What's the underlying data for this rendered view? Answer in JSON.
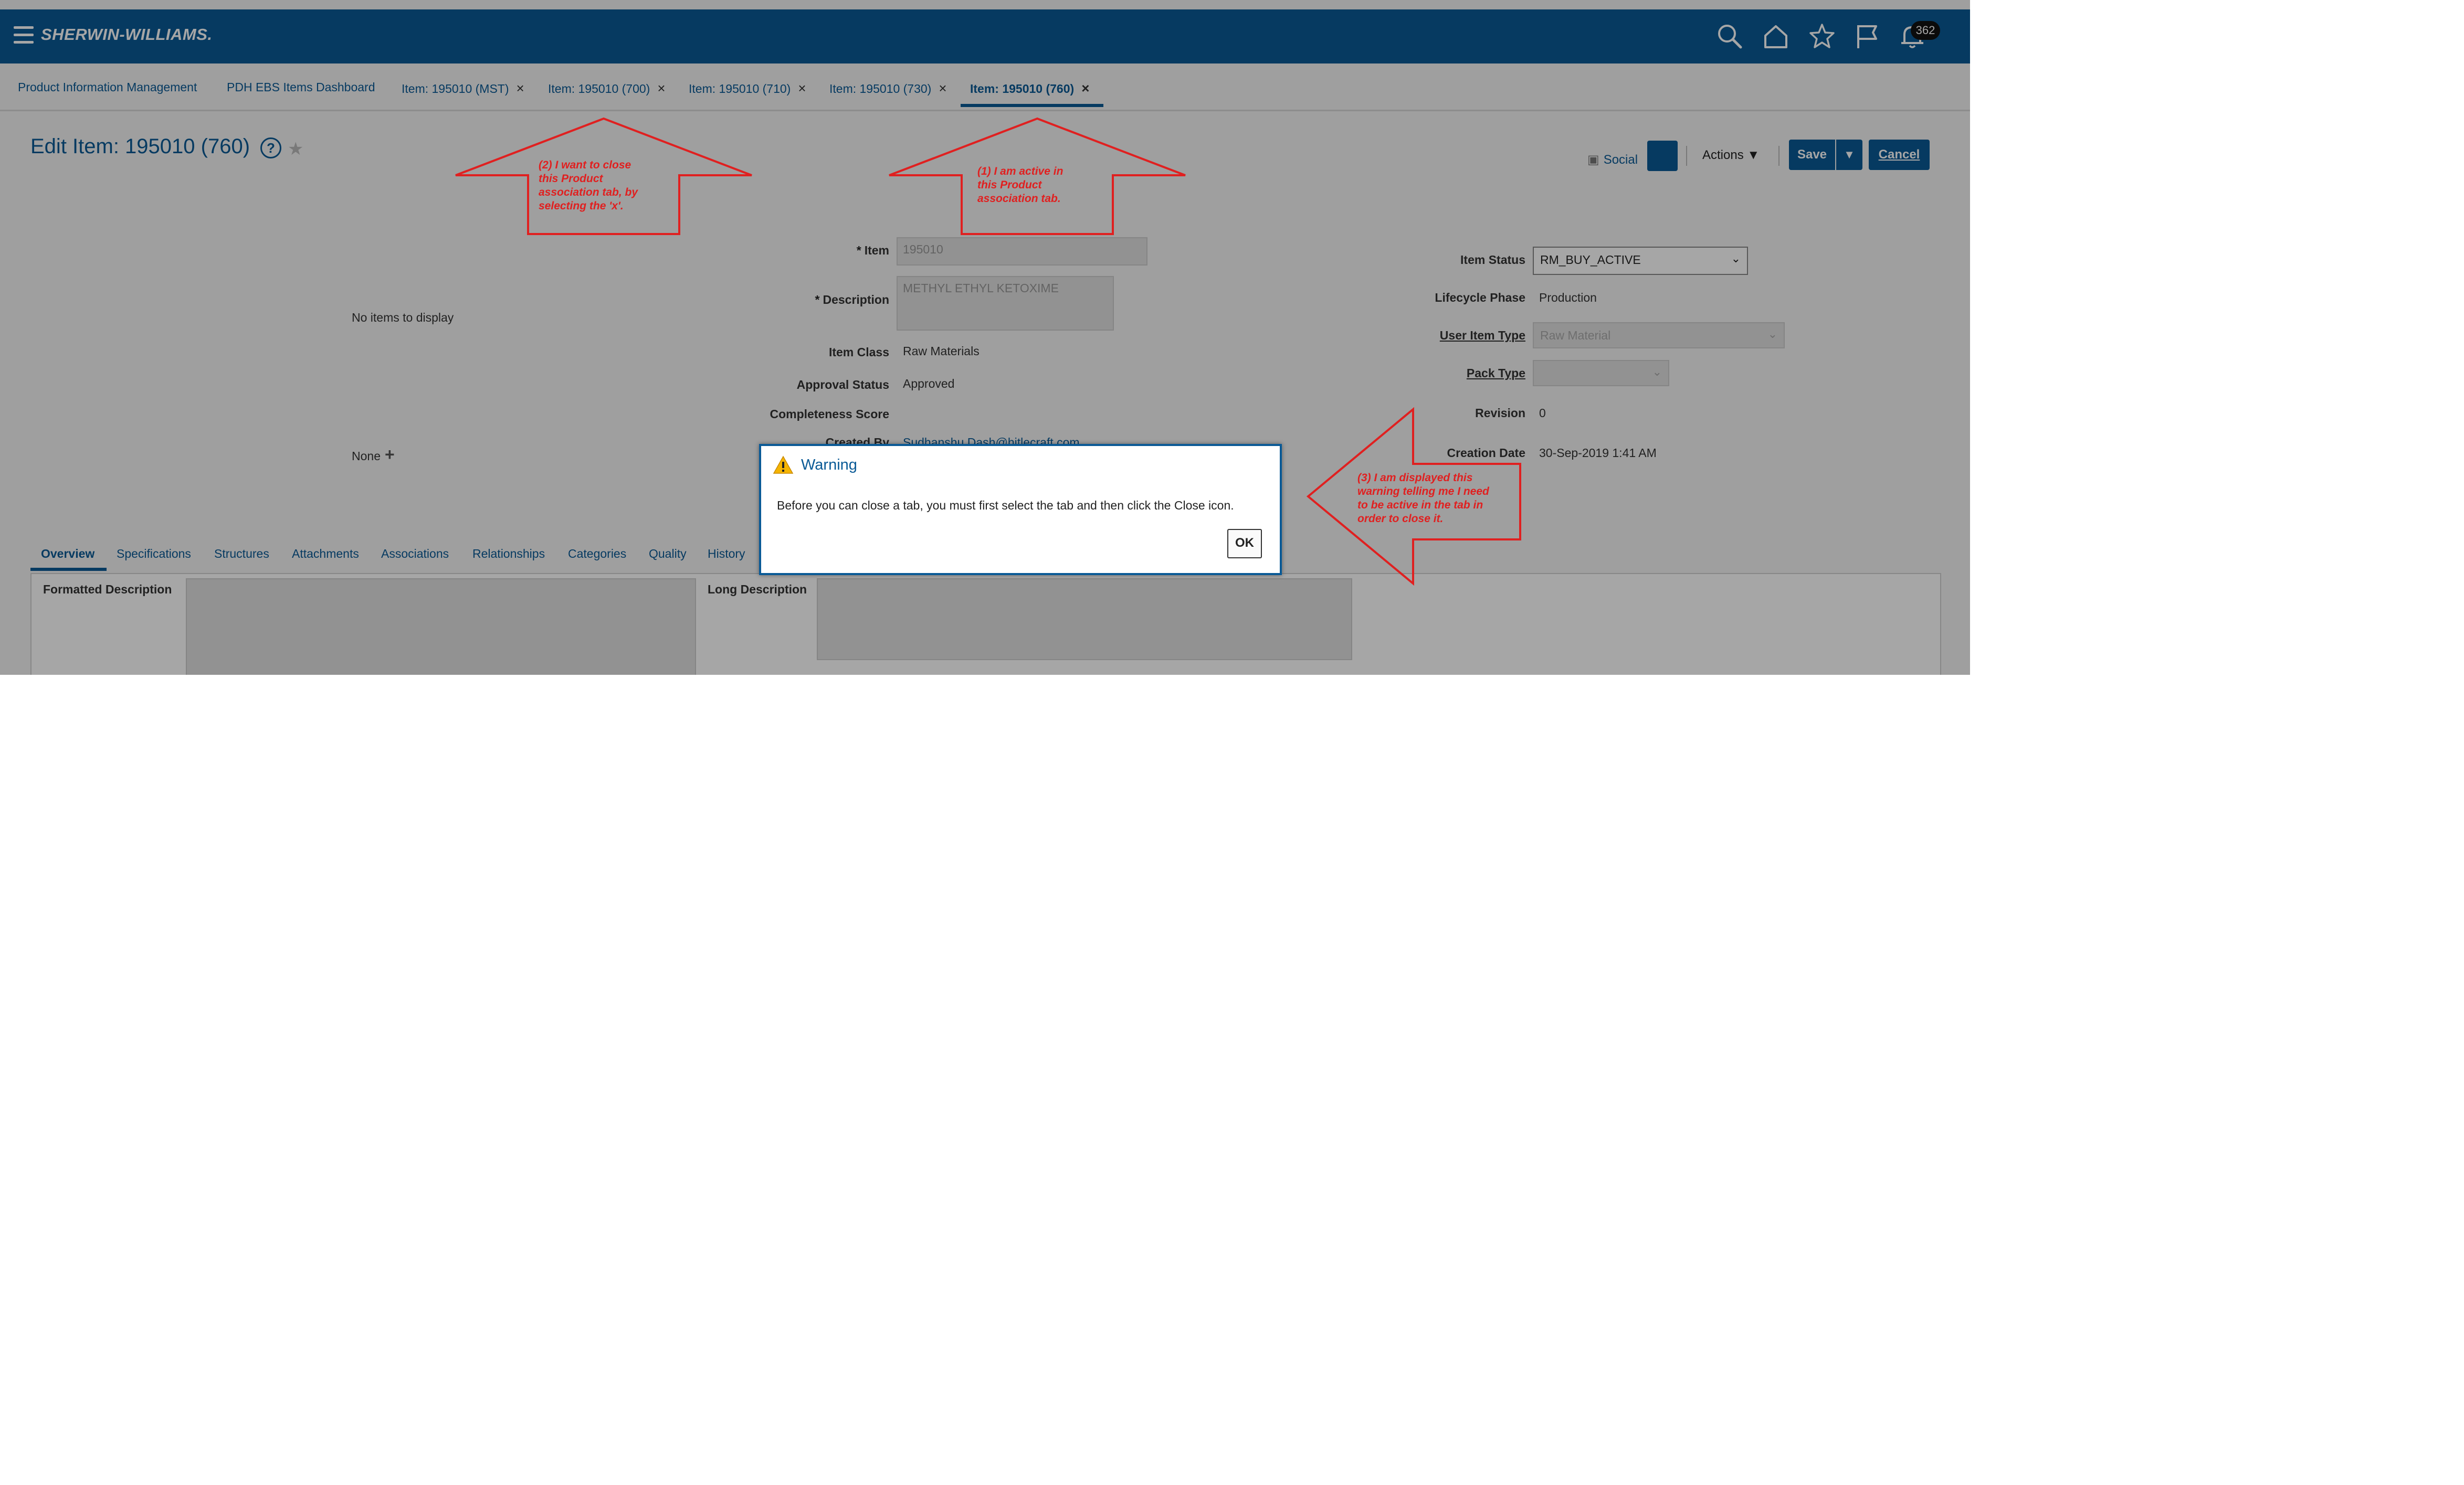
{
  "app": {
    "logo": "SHERWIN-WILLIAMS.",
    "notification_count": "362"
  },
  "tabs": [
    {
      "label": "Product Information Management",
      "closable": false
    },
    {
      "label": "PDH EBS Items Dashboard",
      "closable": false
    },
    {
      "label": "Item: 195010 (MST)",
      "closable": true
    },
    {
      "label": "Item: 195010 (700)",
      "closable": true
    },
    {
      "label": "Item: 195010 (710)",
      "closable": true
    },
    {
      "label": "Item: 195010 (730)",
      "closable": true
    },
    {
      "label": "Item: 195010 (760)",
      "closable": true,
      "active": true
    }
  ],
  "tab_close_glyph": "×",
  "page": {
    "title": "Edit Item: 195010 (760)",
    "help": "?"
  },
  "toolbar": {
    "social": "Social",
    "actions": "Actions",
    "save": "Save",
    "cancel": "Cancel"
  },
  "left_panel": {
    "no_items": "No items to display",
    "none": "None"
  },
  "form": {
    "item": {
      "label": "Item",
      "value": "195010"
    },
    "description": {
      "label": "Description",
      "value": "METHYL ETHYL KETOXIME"
    },
    "item_class": {
      "label": "Item Class",
      "value": "Raw Materials"
    },
    "approval_status": {
      "label": "Approval Status",
      "value": "Approved"
    },
    "completeness_score": {
      "label": "Completeness Score",
      "value": ""
    },
    "created_by": {
      "label": "Created By",
      "value": "Sudhanshu.Dash@hitlecraft.com"
    },
    "item_status": {
      "label": "Item Status",
      "value": "RM_BUY_ACTIVE"
    },
    "lifecycle_phase": {
      "label": "Lifecycle Phase",
      "value": "Production"
    },
    "user_item_type": {
      "label": "User Item Type",
      "value": "Raw Material"
    },
    "pack_type": {
      "label": "Pack Type",
      "value": ""
    },
    "revision": {
      "label": "Revision",
      "value": "0"
    },
    "creation_date": {
      "label": "Creation Date",
      "value": "30-Sep-2019 1:41 AM"
    }
  },
  "section_tabs": [
    "Overview",
    "Specifications",
    "Structures",
    "Attachments",
    "Associations",
    "Relationships",
    "Categories",
    "Quality",
    "History"
  ],
  "overview": {
    "formatted_description": "Formatted Description",
    "long_description": "Long Description"
  },
  "dialog": {
    "title": "Warning",
    "message": "Before you can close a tab, you must first select the tab and then click the Close icon.",
    "ok": "OK"
  },
  "annotations": {
    "a2": [
      "(2) I want to close",
      "this Product",
      "association tab, by",
      "selecting the 'x'."
    ],
    "a1": [
      "(1) I am active in",
      "this Product",
      "association tab."
    ],
    "a3": [
      "(3) I am displayed this",
      "warning telling me I need",
      "to be active in the tab in",
      "order to close it."
    ]
  },
  "colors": {
    "brand": "#0a5a96",
    "annotation": "#e02020",
    "warning": "#f5b400"
  }
}
